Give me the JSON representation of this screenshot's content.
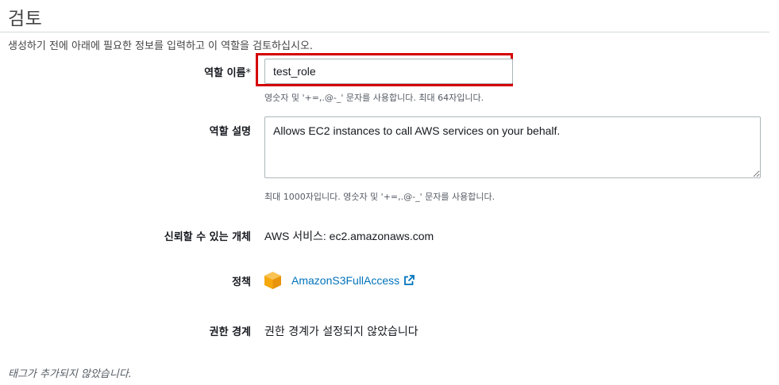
{
  "header": {
    "title": "검토",
    "subtitle": "생성하기 전에 아래에 필요한 정보를 입력하고 이 역할을 검토하십시오."
  },
  "role_name": {
    "label": "역할 이름",
    "required_marker": "*",
    "value": "test_role",
    "hint": "영숫자 및 '+=,.@-_' 문자를 사용합니다. 최대 64자입니다."
  },
  "role_description": {
    "label": "역할 설명",
    "value": "Allows EC2 instances to call AWS services on your behalf.",
    "hint": "최대 1000자입니다. 영숫자 및 '+=,.@-_' 문자를 사용합니다."
  },
  "trusted_entity": {
    "label": "신뢰할 수 있는 개체",
    "value": "AWS 서비스: ec2.amazonaws.com"
  },
  "policies": {
    "label": "정책",
    "items": [
      {
        "name": "AmazonS3FullAccess",
        "icon": "aws-managed-policy-cube-icon"
      }
    ]
  },
  "permissions_boundary": {
    "label": "권한 경계",
    "value": "권한 경계가 설정되지 않았습니다"
  },
  "tags": {
    "note": "태그가 추가되지 않았습니다."
  },
  "colors": {
    "link": "#0073bb",
    "highlight": "#d40000",
    "policy_icon": "#f7a80d"
  }
}
